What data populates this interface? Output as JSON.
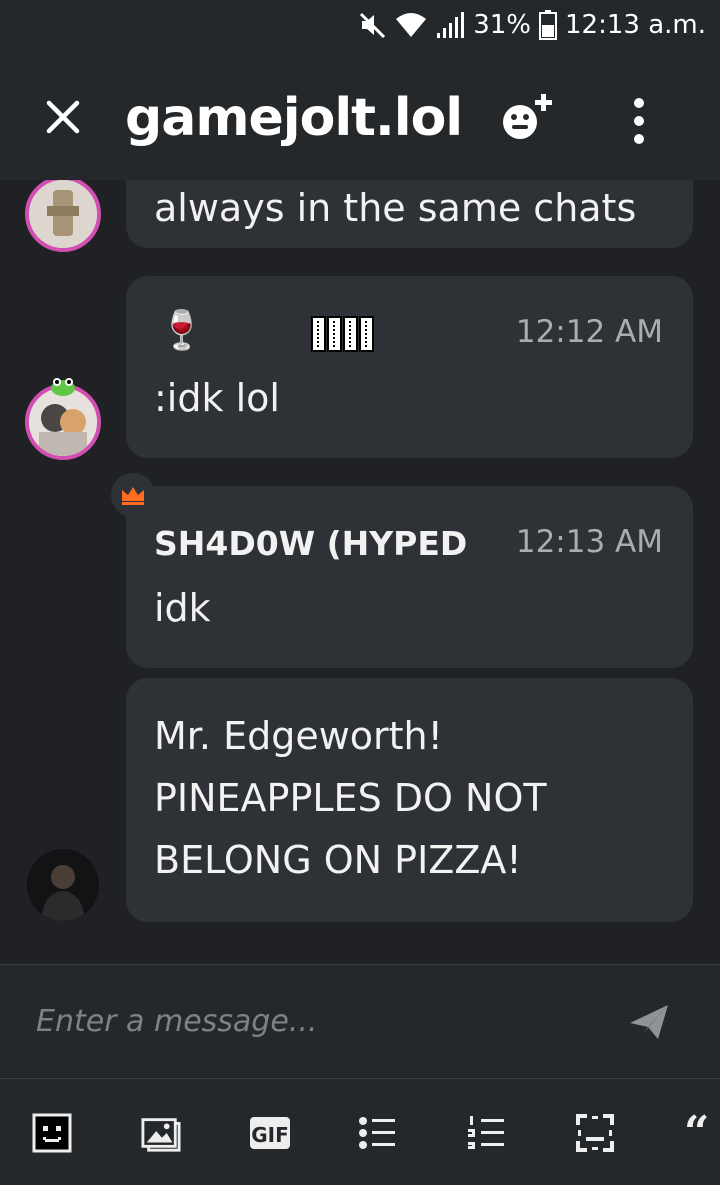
{
  "status_bar": {
    "battery": "31%",
    "time": "12:13 a.m."
  },
  "header": {
    "title": "gamejolt.lol"
  },
  "messages": [
    {
      "text": "always in the same chats"
    },
    {
      "time": "12:12 AM",
      "text": ":idk lol",
      "decor": "🍷"
    },
    {
      "name": "SH4D0W (HYPED",
      "time": "12:13 AM",
      "text": "idk"
    },
    {
      "lines": [
        "Mr. Edgeworth!",
        "PINEAPPLES DO NOT",
        "BELONG ON PIZZA!"
      ]
    }
  ],
  "composer": {
    "placeholder": "Enter a message..."
  },
  "toolbar": {
    "gif_label": "GIF",
    "quote_label": "“"
  },
  "colors": {
    "background": "#1f2124",
    "bar": "#25282b",
    "bubble": "#2e3136",
    "avatar_ring": "#d14fb0",
    "crown": "#ff6b1f"
  }
}
